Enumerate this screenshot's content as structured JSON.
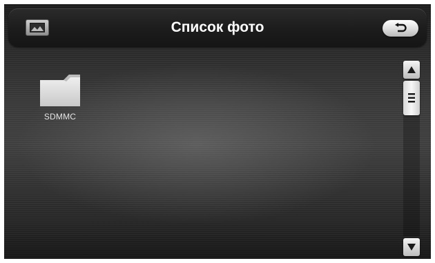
{
  "header": {
    "title": "Список фото",
    "photo_icon": "photo-icon",
    "back_icon": "back-arrow-icon"
  },
  "folders": [
    {
      "label": "SDMMC",
      "icon": "folder-icon"
    }
  ],
  "scrollbar": {
    "up_icon": "triangle-up-icon",
    "down_icon": "triangle-down-icon",
    "thumb_icon": "grip-lines-icon"
  },
  "colors": {
    "title_text": "#ffffff",
    "folder": "#e8e8e8",
    "background": "#3a3a3a"
  }
}
